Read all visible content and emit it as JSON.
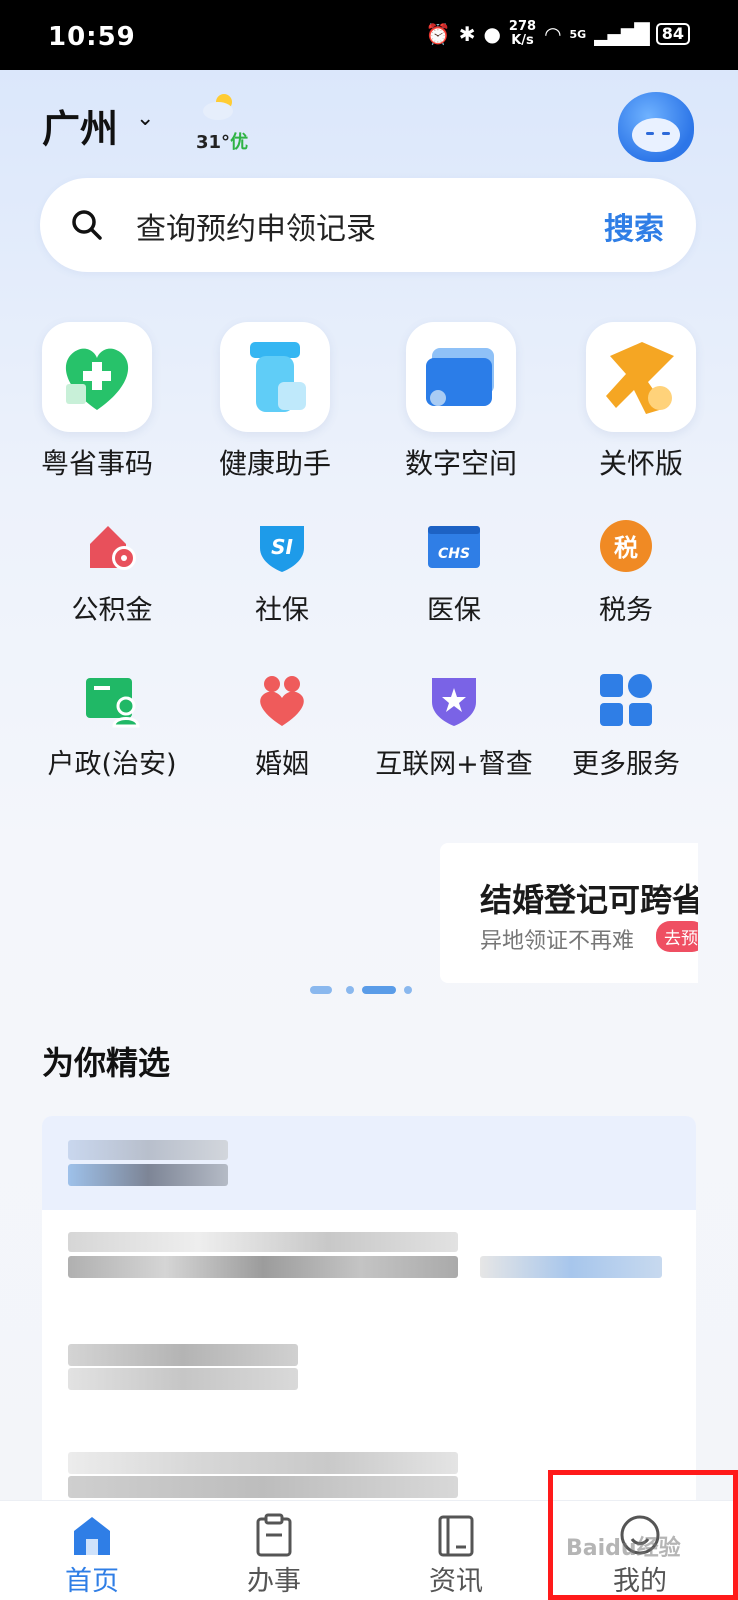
{
  "status_bar": {
    "time": "10:59",
    "speed_value": "278",
    "speed_unit": "K/s",
    "network": "5G",
    "battery": "84"
  },
  "header": {
    "city": "广州",
    "weather_temp": "31°",
    "weather_aqi": "优",
    "avatar_icon": "robot-mascot-icon"
  },
  "search": {
    "placeholder": "查询预约申领记录",
    "button_label": "搜索"
  },
  "featured_services": [
    {
      "label": "粤省事码",
      "icon": "health-code-heart-icon",
      "color": "#27c26a"
    },
    {
      "label": "健康助手",
      "icon": "health-assistant-bottle-icon",
      "color": "#35b6f2"
    },
    {
      "label": "数字空间",
      "icon": "digital-space-cards-icon",
      "color": "#2b7de8"
    },
    {
      "label": "关怀版",
      "icon": "care-scarf-icon",
      "color": "#f5a623"
    }
  ],
  "services_row1": [
    {
      "label": "公积金",
      "icon": "housing-fund-icon",
      "color": "#e8505b"
    },
    {
      "label": "社保",
      "icon": "social-security-shield-icon",
      "color": "#1e9be9"
    },
    {
      "label": "医保",
      "icon": "medical-insurance-chs-icon",
      "color": "#2f7ee6"
    },
    {
      "label": "税务",
      "icon": "tax-icon",
      "color": "#f08a24"
    }
  ],
  "services_row2": [
    {
      "label": "户政(治安)",
      "icon": "household-registration-icon",
      "color": "#20b866"
    },
    {
      "label": "婚姻",
      "icon": "marriage-icon",
      "color": "#ef5b5b"
    },
    {
      "label": "互联网+督查",
      "icon": "supervision-star-badge-icon",
      "color": "#7a63e6"
    },
    {
      "label": "更多服务",
      "icon": "more-services-grid-icon",
      "color": "#2f7ee6"
    }
  ],
  "chs_text": "CHS",
  "si_text": "SI",
  "tax_glyph": "税",
  "banner": {
    "title": "结婚登记可跨省",
    "subtitle": "异地领证不再难",
    "cta": "去预"
  },
  "section": {
    "title": "为你精选"
  },
  "tabbar": {
    "tabs": [
      {
        "label": "首页",
        "icon": "home-icon",
        "active": true
      },
      {
        "label": "办事",
        "icon": "clipboard-icon",
        "active": false
      },
      {
        "label": "资讯",
        "icon": "news-book-icon",
        "active": false
      },
      {
        "label": "我的",
        "icon": "profile-smile-icon",
        "active": false
      }
    ]
  },
  "watermark": "Baidu经验",
  "colors": {
    "accent": "#2f7ee6",
    "highlight": "#ff1a1a"
  }
}
